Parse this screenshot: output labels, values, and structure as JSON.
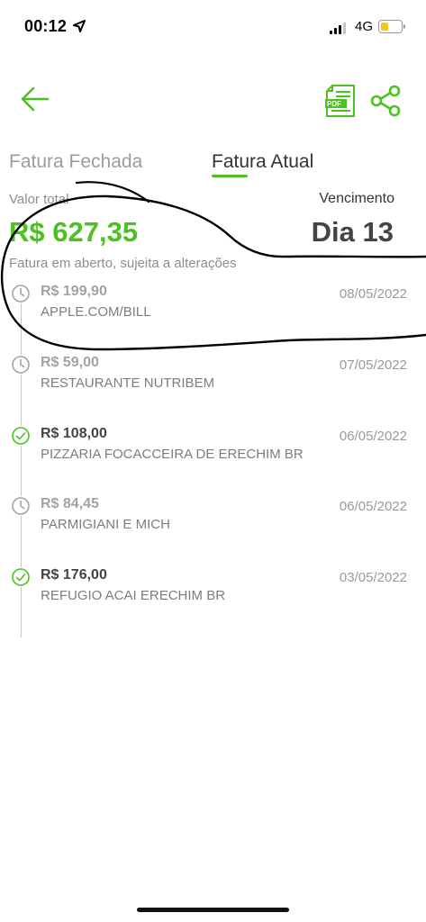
{
  "status_bar": {
    "time": "00:12",
    "network": "4G"
  },
  "tabs": {
    "closed": "Fatura Fechada",
    "current": "Fatura Atual"
  },
  "summary": {
    "total_label": "Valor total",
    "total_value": "R$ 627,35",
    "due_label": "Vencimento",
    "due_value": "Dia 13",
    "note": "Fatura em aberto, sujeita a alterações"
  },
  "transactions": [
    {
      "amount": "R$ 199,90",
      "merchant": "APPLE.COM/BILL",
      "date": "08/05/2022",
      "status": "pending"
    },
    {
      "amount": "R$ 59,00",
      "merchant": "RESTAURANTE NUTRIBEM",
      "date": "07/05/2022",
      "status": "pending"
    },
    {
      "amount": "R$ 108,00",
      "merchant": "PIZZARIA FOCACCEIRA DE ERECHIM BR",
      "date": "06/05/2022",
      "status": "confirmed"
    },
    {
      "amount": "R$ 84,45",
      "merchant": "PARMIGIANI E MICH",
      "date": "06/05/2022",
      "status": "pending"
    },
    {
      "amount": "R$ 176,00",
      "merchant": "REFUGIO ACAI ERECHIM BR",
      "date": "03/05/2022",
      "status": "confirmed"
    }
  ],
  "icons": {
    "back": "back-arrow-icon",
    "pdf": "pdf-document-icon",
    "share": "share-icon",
    "pending": "clock-icon",
    "confirmed": "check-circle-icon"
  },
  "colors": {
    "accent": "#4cc11f",
    "text_dark": "#333333",
    "text_muted": "#8d8d8d"
  }
}
